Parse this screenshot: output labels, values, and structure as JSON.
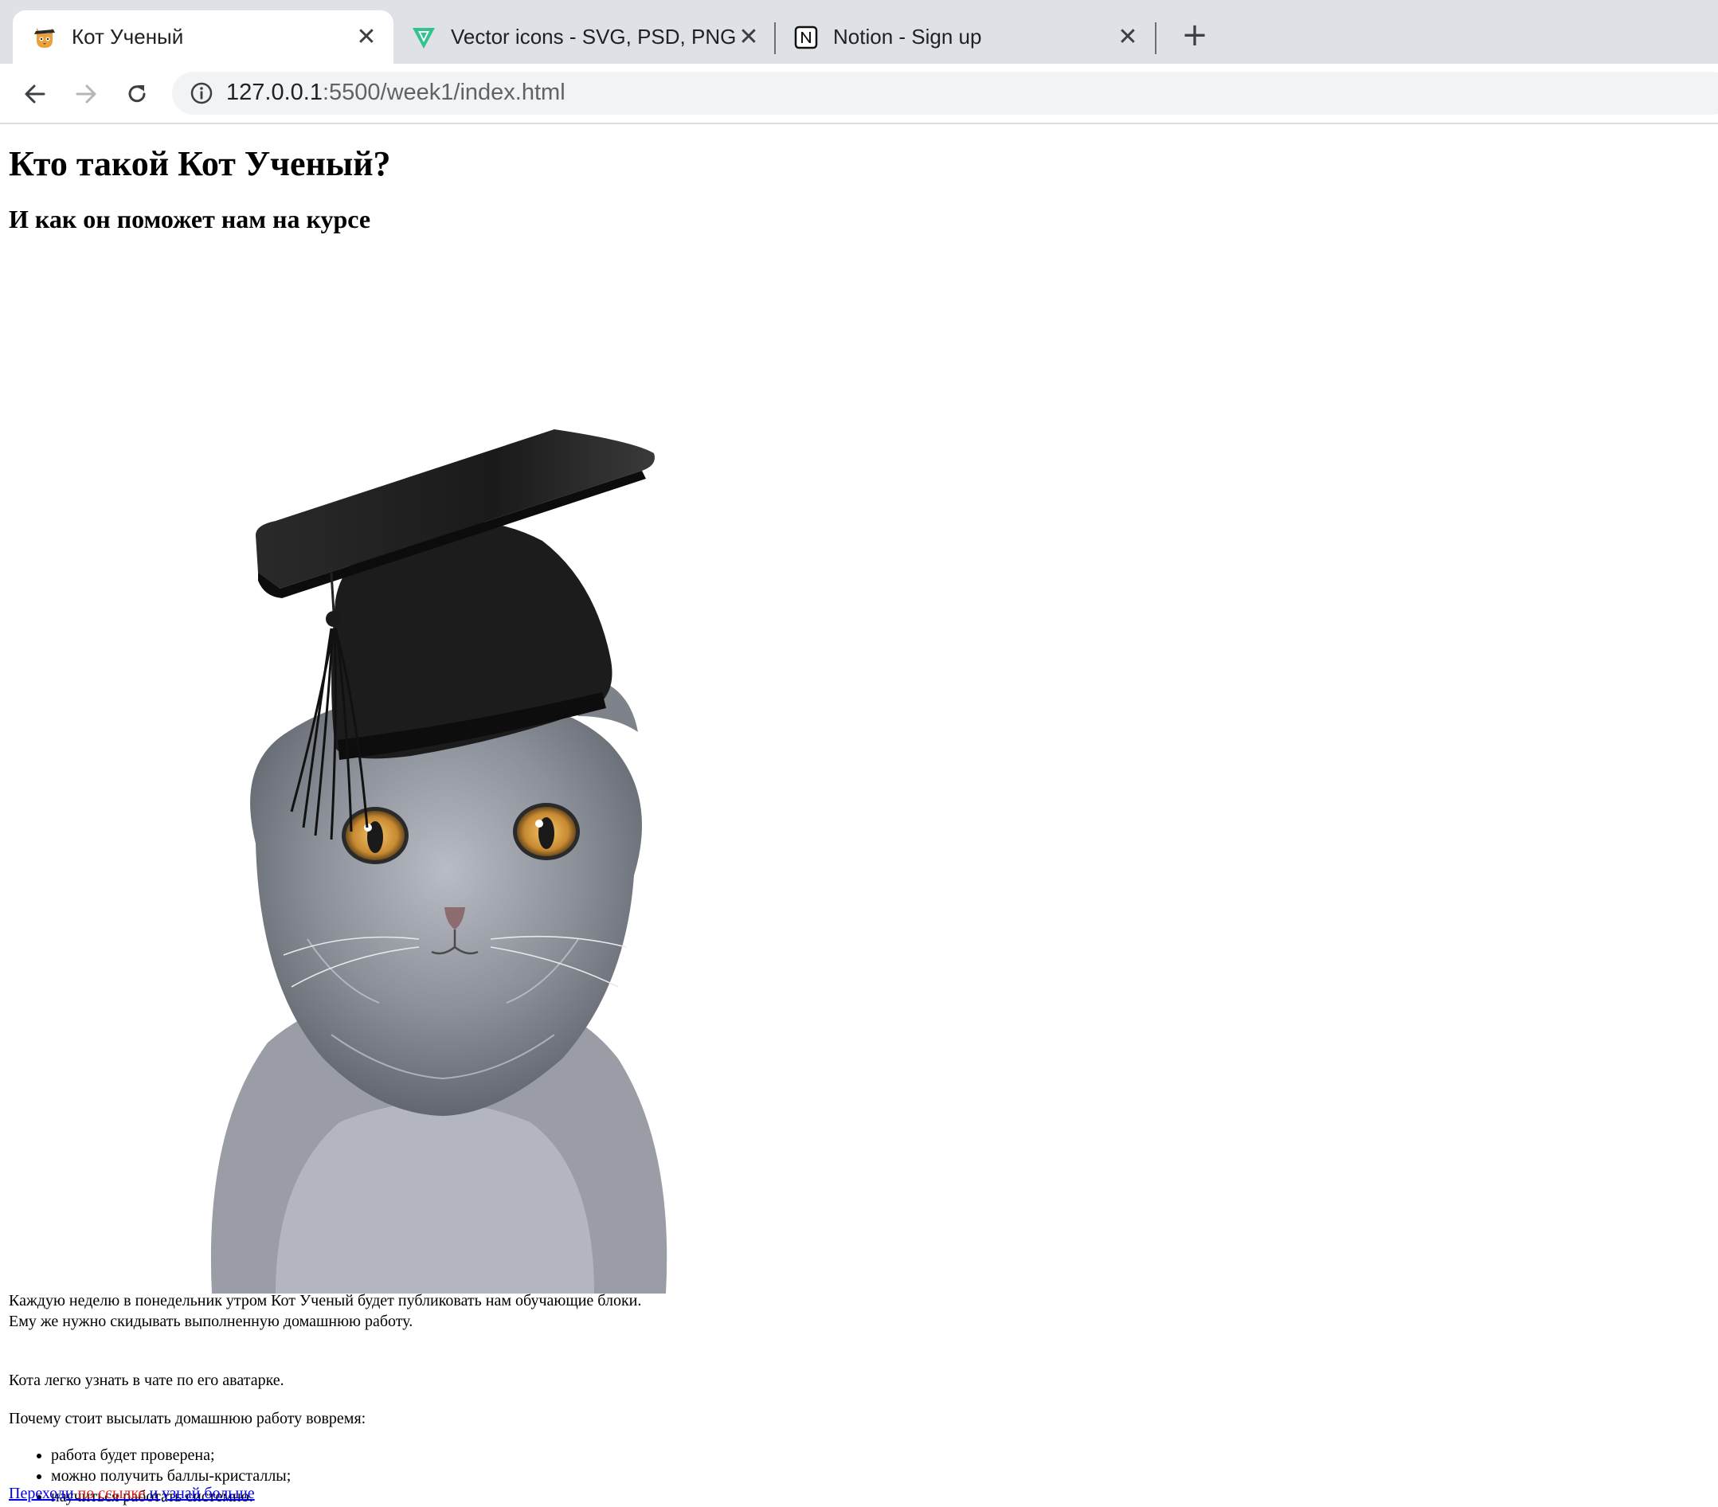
{
  "browser": {
    "tabs": [
      {
        "title": "Кот Ученый",
        "active": true,
        "favicon": "cat-favicon-icon"
      },
      {
        "title": "Vector icons - SVG, PSD, PNG, EPS & Icon Font",
        "active": false,
        "favicon": "freepik-favicon-icon"
      },
      {
        "title": "Notion - Sign up",
        "active": false,
        "favicon": "notion-favicon-icon"
      }
    ],
    "address": {
      "host": "127.0.0.1",
      "path": ":5500/week1/index.html"
    }
  },
  "page": {
    "title": "Кто такой Кот Ученый?",
    "subtitle": "И как он поможет нам на курсе",
    "image_alt": "cat in graduation cap",
    "paragraph1_line1": "Каждую неделю в понедельник утром Кот Ученый будет публиковать нам обучающие блоки.",
    "paragraph1_line2": "Ему же нужно скидывать выполненную домашнюю работу.",
    "paragraph2": "Кота легко узнать в чате по его аватарке.",
    "paragraph3": "Почему стоит высылать домашнюю работу вовремя:",
    "reasons": [
      "работа будет проверена;",
      "можно получить баллы-кристаллы;",
      "научиться работать системно."
    ],
    "link": {
      "part1": "Переходи ",
      "part2": "по ссылке",
      "part3": " и узнай больше"
    }
  },
  "colors": {
    "link": "#0000ee",
    "link_highlight": "#e0201c",
    "tabbar_bg": "#dee1e6"
  }
}
